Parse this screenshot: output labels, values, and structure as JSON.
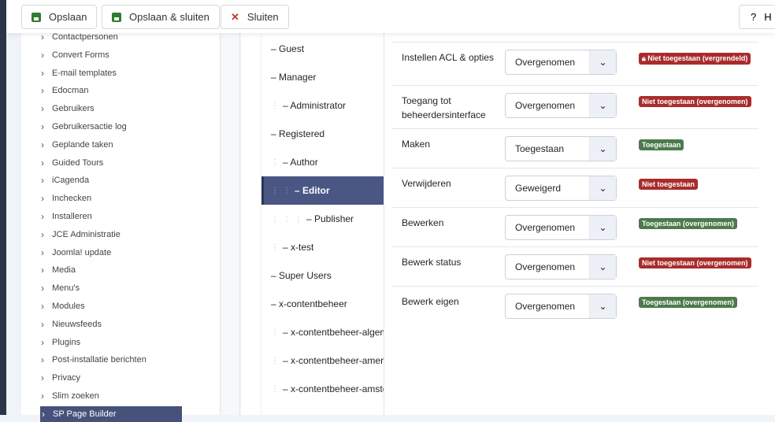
{
  "toolbar": {
    "save": "Opslaan",
    "save_close": "Opslaan & sluiten",
    "close": "Sluiten",
    "help_icon": "?",
    "help": "H"
  },
  "sidebar": {
    "items": [
      "Contactpersonen",
      "Convert Forms",
      "E-mail templates",
      "Edocman",
      "Gebruikers",
      "Gebruikersactie log",
      "Geplande taken",
      "Guided Tours",
      "iCagenda",
      "Inchecken",
      "Installeren",
      "JCE Administratie",
      "Joomla! update",
      "Media",
      "Menu's",
      "Modules",
      "Nieuwsfeeds",
      "Plugins",
      "Post-installatie berichten",
      "Privacy",
      "Slim zoeken",
      "SP Page Builder"
    ]
  },
  "groups": [
    {
      "name": "– Guest",
      "depth": 0
    },
    {
      "name": "– Manager",
      "depth": 0
    },
    {
      "name": "– Administrator",
      "depth": 1
    },
    {
      "name": "– Registered",
      "depth": 0
    },
    {
      "name": "– Author",
      "depth": 1
    },
    {
      "name": "– Editor",
      "depth": 2,
      "active": true
    },
    {
      "name": "– Publisher",
      "depth": 3
    },
    {
      "name": "– x-test",
      "depth": 1
    },
    {
      "name": "– Super Users",
      "depth": 0
    },
    {
      "name": "– x-contentbeheer",
      "depth": 0
    },
    {
      "name": "– x-contentbeheer-algem",
      "depth": 1
    },
    {
      "name": "– x-contentbeheer-amers",
      "depth": 1
    },
    {
      "name": "– x-contentbeheer-amste",
      "depth": 1
    }
  ],
  "permissions": [
    {
      "label": "Instellen ACL & opties",
      "value": "Overgenomen",
      "badge": "Niet toegestaan (vergrendeld)",
      "status": "red",
      "locked": true
    },
    {
      "label": "Toegang tot beheerdersinterface",
      "value": "Overgenomen",
      "badge": "Niet toegestaan (overgenomen)",
      "status": "red"
    },
    {
      "label": "Maken",
      "value": "Toegestaan",
      "badge": "Toegestaan",
      "status": "green"
    },
    {
      "label": "Verwijderen",
      "value": "Geweigerd",
      "badge": "Niet toegestaan",
      "status": "red"
    },
    {
      "label": "Bewerken",
      "value": "Overgenomen",
      "badge": "Toegestaan (overgenomen)",
      "status": "green"
    },
    {
      "label": "Bewerk status",
      "value": "Overgenomen",
      "badge": "Niet toegestaan (overgenomen)",
      "status": "red"
    },
    {
      "label": "Bewerk eigen",
      "value": "Overgenomen",
      "badge": "Toegestaan (overgenomen)",
      "status": "green"
    }
  ]
}
